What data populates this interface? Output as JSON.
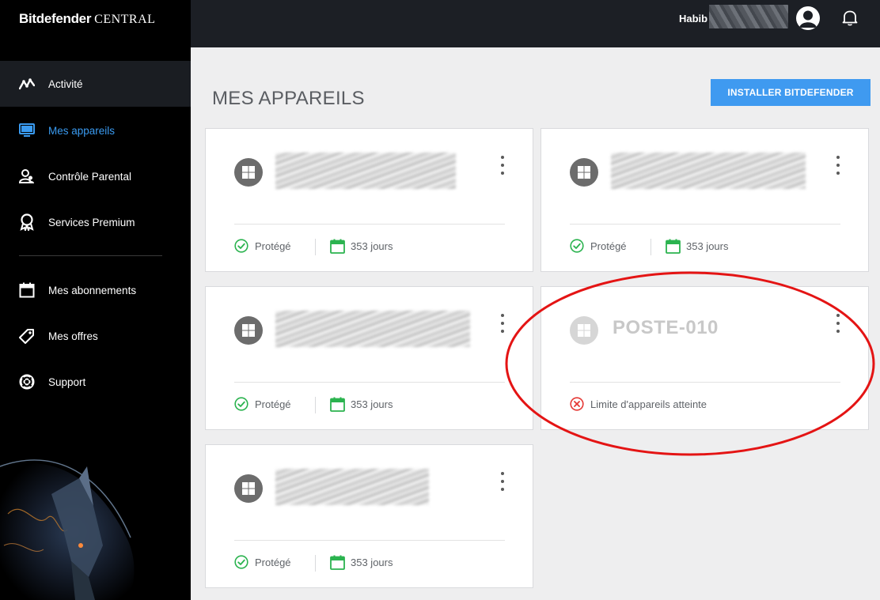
{
  "sidebar": {
    "logo_brand": "Bitdefender",
    "logo_product": "CENTRAL",
    "items": [
      {
        "label": "Activité",
        "icon": "activity-icon"
      },
      {
        "label": "Mes appareils",
        "icon": "monitor-icon"
      },
      {
        "label": "Contrôle Parental",
        "icon": "parental-control-icon"
      },
      {
        "label": "Services Premium",
        "icon": "premium-ribbon-icon"
      },
      {
        "label": "Mes abonnements",
        "icon": "calendar-icon"
      },
      {
        "label": "Mes offres",
        "icon": "tag-icon"
      },
      {
        "label": "Support",
        "icon": "lifebuoy-icon"
      }
    ]
  },
  "header": {
    "username": "Habib",
    "avatar_icon": "user-avatar-icon",
    "bell_icon": "notification-bell-icon"
  },
  "main": {
    "title": "MES APPAREILS",
    "install_button": "INSTALLER BITDEFENDER",
    "devices": [
      {
        "name": "",
        "status": "Protégé",
        "days": "353 jours"
      },
      {
        "name": "",
        "status": "Protégé",
        "days": "353 jours"
      },
      {
        "name": "",
        "status": "Protégé",
        "days": "353 jours"
      },
      {
        "name": "POSTE-010",
        "status": "Limite d'appareils atteinte",
        "days": ""
      },
      {
        "name": "",
        "status": "Protégé",
        "days": "353 jours"
      }
    ]
  },
  "colors": {
    "accent": "#3f9af0",
    "protected": "#2bb34f",
    "error": "#e53935",
    "annotation": "#e41414"
  }
}
